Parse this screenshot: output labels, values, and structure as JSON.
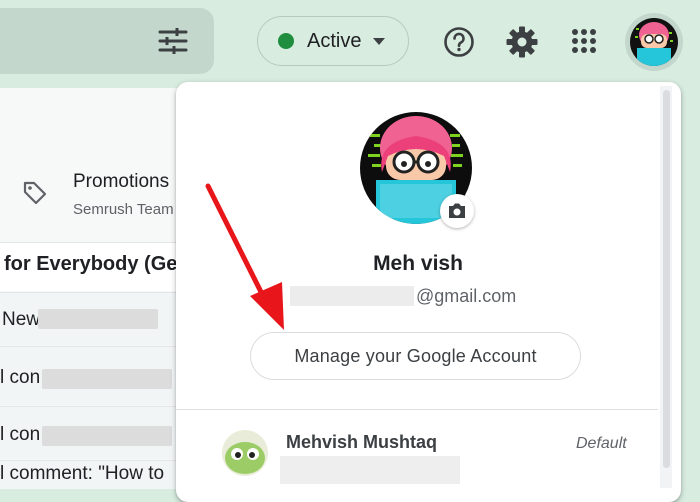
{
  "status": {
    "label": "Active",
    "color": "#1e8e3e"
  },
  "icons": {
    "filter": "search-options-icon",
    "help": "help-icon",
    "settings": "gear-icon",
    "apps": "apps-grid-icon",
    "camera": "camera-icon",
    "tag": "label-tag-icon"
  },
  "mail": {
    "promotions": {
      "title": "Promotions",
      "sender": "Semrush Team"
    },
    "rows": [
      {
        "text": "for Everybody (Ge"
      },
      {
        "text": "New"
      },
      {
        "text": "l con"
      },
      {
        "text": "l con"
      },
      {
        "text": "l comment: \"How to"
      }
    ]
  },
  "account_popup": {
    "name": "Meh vish",
    "email_suffix": "@gmail.com",
    "manage_button": "Manage your Google Account",
    "accounts": [
      {
        "name": "Mehvish Mushtaq",
        "badge": "Default"
      }
    ]
  }
}
